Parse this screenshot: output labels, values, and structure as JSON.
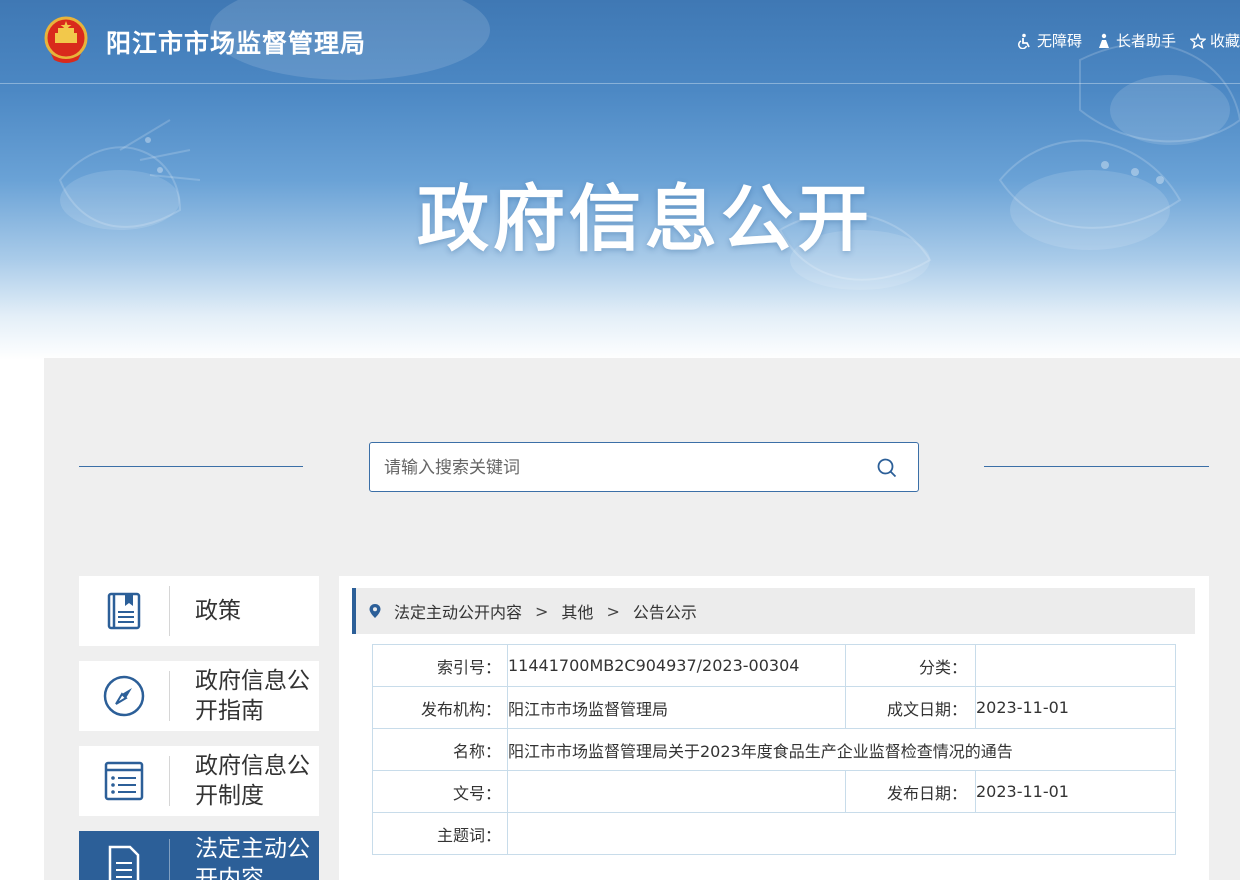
{
  "header": {
    "site_name": "阳江市市场监督管理局",
    "tools": [
      {
        "label": "无障碍",
        "icon": "accessibility-icon"
      },
      {
        "label": "长者助手",
        "icon": "elder-helper-icon"
      },
      {
        "label": "收藏",
        "icon": "star-icon"
      }
    ]
  },
  "hero": {
    "title": "政府信息公开"
  },
  "search": {
    "placeholder": "请输入搜索关键词",
    "icon": "search-icon"
  },
  "sidebar": {
    "items": [
      {
        "label": "政策",
        "icon": "book-icon"
      },
      {
        "label": "政府信息公开指南",
        "icon": "compass-icon"
      },
      {
        "label": "政府信息公开制度",
        "icon": "list-document-icon"
      },
      {
        "label": "法定主动公开内容",
        "icon": "document-icon",
        "active": true
      }
    ]
  },
  "breadcrumb": {
    "icon": "location-pin-icon",
    "items": [
      "法定主动公开内容",
      "其他",
      "公告公示"
    ],
    "separator": ">"
  },
  "meta": {
    "index_label": "索引号：",
    "index_value": "11441700MB2C904937/2023-00304",
    "category_label": "分类：",
    "category_value": "",
    "issuer_label": "发布机构：",
    "issuer_value": "阳江市市场监督管理局",
    "created_label": "成文日期：",
    "created_value": "2023-11-01",
    "name_label": "名称：",
    "name_value": "阳江市市场监督管理局关于2023年度食品生产企业监督检查情况的通告",
    "docno_label": "文号：",
    "docno_value": "",
    "published_label": "发布日期：",
    "published_value": "2023-11-01",
    "keywords_label": "主题词：",
    "keywords_value": ""
  },
  "colors": {
    "brand_blue": "#2c5f98",
    "banner_blue": "#4c88c4",
    "panel_bg": "#efefef",
    "table_border": "#c8dcea"
  }
}
